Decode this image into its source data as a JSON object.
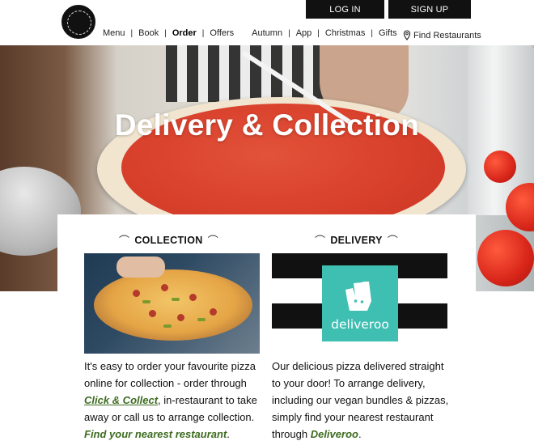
{
  "header": {
    "login_label": "LOG IN",
    "signup_label": "SIGN UP",
    "nav": [
      "Menu",
      "Book",
      "Order",
      "Offers",
      "Autumn",
      "App",
      "Christmas",
      "Gifts"
    ],
    "find_label": "Find Restaurants"
  },
  "hero": {
    "title": "Delivery & Collection"
  },
  "collection": {
    "heading": "COLLECTION",
    "text_1": "It's easy to order your favourite pizza online for collection - order through ",
    "link_1": "Click & Collect",
    "text_2": ", in-restaurant to take away or call us to arrange collection. ",
    "link_2": "Find your nearest restaurant",
    "text_3": "."
  },
  "delivery": {
    "heading": "DELIVERY",
    "brand": "deliveroo",
    "text_1": "Our delicious pizza delivered straight to your door! To arrange delivery, including our vegan bundles & pizzas, simply find your nearest restaurant through ",
    "link_1": "Deliveroo",
    "text_2": "."
  },
  "colors": {
    "link_green": "#3d6b1f",
    "deliveroo_teal": "#3ebfb2",
    "header_button": "#111111"
  },
  "icons": [
    "pizza-express-logo",
    "location-pin-icon"
  ]
}
